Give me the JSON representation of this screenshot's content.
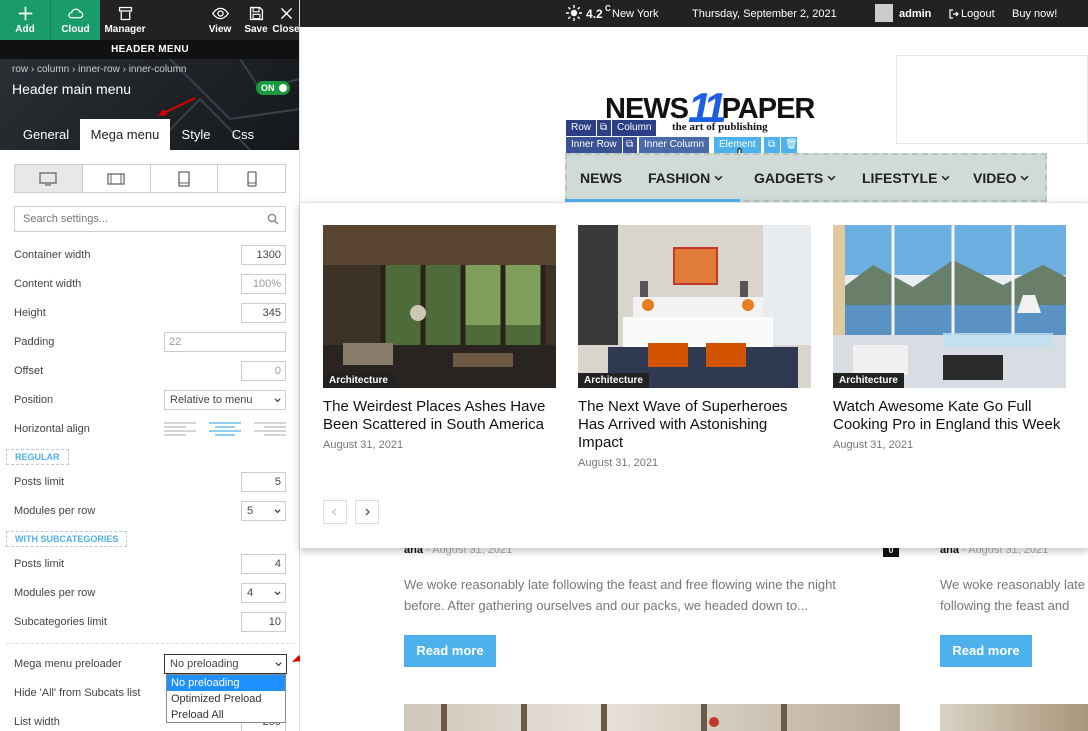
{
  "toolbar": {
    "add": "Add",
    "cloud": "Cloud",
    "manager": "Manager",
    "view": "View",
    "save": "Save",
    "close": "Close"
  },
  "panel": {
    "section_title": "HEADER MENU",
    "breadcrumb": "row › column › inner-row › inner-column",
    "title": "Header main menu",
    "toggle": "ON",
    "tabs": [
      "General",
      "Mega menu",
      "Style",
      "Css"
    ],
    "active_tab": "Mega menu",
    "search_placeholder": "Search settings...",
    "settings": {
      "container_width": {
        "label": "Container width",
        "value": "1300"
      },
      "content_width": {
        "label": "Content width",
        "value": "100%"
      },
      "height": {
        "label": "Height",
        "value": "345"
      },
      "padding": {
        "label": "Padding",
        "value": "22"
      },
      "offset": {
        "label": "Offset",
        "value": "0"
      },
      "position": {
        "label": "Position",
        "value": "Relative to menu"
      },
      "horizontal_align": {
        "label": "Horizontal align",
        "selected": "center"
      }
    },
    "regular": {
      "header": "REGULAR",
      "posts_limit": {
        "label": "Posts limit",
        "value": "5"
      },
      "modules_per_row": {
        "label": "Modules per row",
        "value": "5"
      }
    },
    "subcats": {
      "header": "WITH SUBCATEGORIES",
      "posts_limit": {
        "label": "Posts limit",
        "value": "4"
      },
      "modules_per_row": {
        "label": "Modules per row",
        "value": "4"
      },
      "subcategories_limit": {
        "label": "Subcategories limit",
        "value": "10"
      }
    },
    "preloader": {
      "label": "Mega menu preloader",
      "value": "No preloading",
      "options": [
        "No preloading",
        "Optimized Preload",
        "Preload All"
      ]
    },
    "hide_all": {
      "label": "Hide 'All' from Subcats list"
    },
    "list_width": {
      "label": "List width",
      "value": "200"
    }
  },
  "topbar": {
    "temp": "4.2",
    "unit": "C",
    "city": "New York",
    "date": "Thursday, September 2, 2021",
    "user": "admin",
    "logout": "Logout",
    "buy": "Buy now!"
  },
  "site": {
    "logo_left": "NEWS",
    "logo_num": "11",
    "logo_right": "PAPER",
    "tagline": "the art of publishing",
    "toolkit": {
      "row": "Row",
      "column": "Column",
      "inner_row": "Inner Row",
      "inner_column": "Inner Column",
      "element": "Element"
    },
    "nav": [
      "NEWS",
      "FASHION",
      "GADGETS",
      "LIFESTYLE",
      "VIDEO"
    ],
    "cards": [
      {
        "category": "Architecture",
        "title": "The Weirdest Places Ashes Have Been Scattered in South America",
        "date": "August 31, 2021"
      },
      {
        "category": "Architecture",
        "title": "The Next Wave of Superheroes Has Arrived with Astonishing Impact",
        "date": "August 31, 2021"
      },
      {
        "category": "Architecture",
        "title": "Watch Awesome Kate Go Full Cooking Pro in England this Week",
        "date": "August 31, 2021"
      }
    ],
    "posts": [
      {
        "author": "ana",
        "date": "August 31, 2021",
        "comments": "0",
        "excerpt": "We woke reasonably late following the feast and free flowing wine the night before. After gathering ourselves and our packs, we headed down to...",
        "read_more": "Read more"
      },
      {
        "author": "ana",
        "date": "August 31, 2021",
        "excerpt": "We woke reasonably late following the feast and free flowing wine the night before. After gathering o",
        "read_more": "Read more"
      }
    ]
  }
}
